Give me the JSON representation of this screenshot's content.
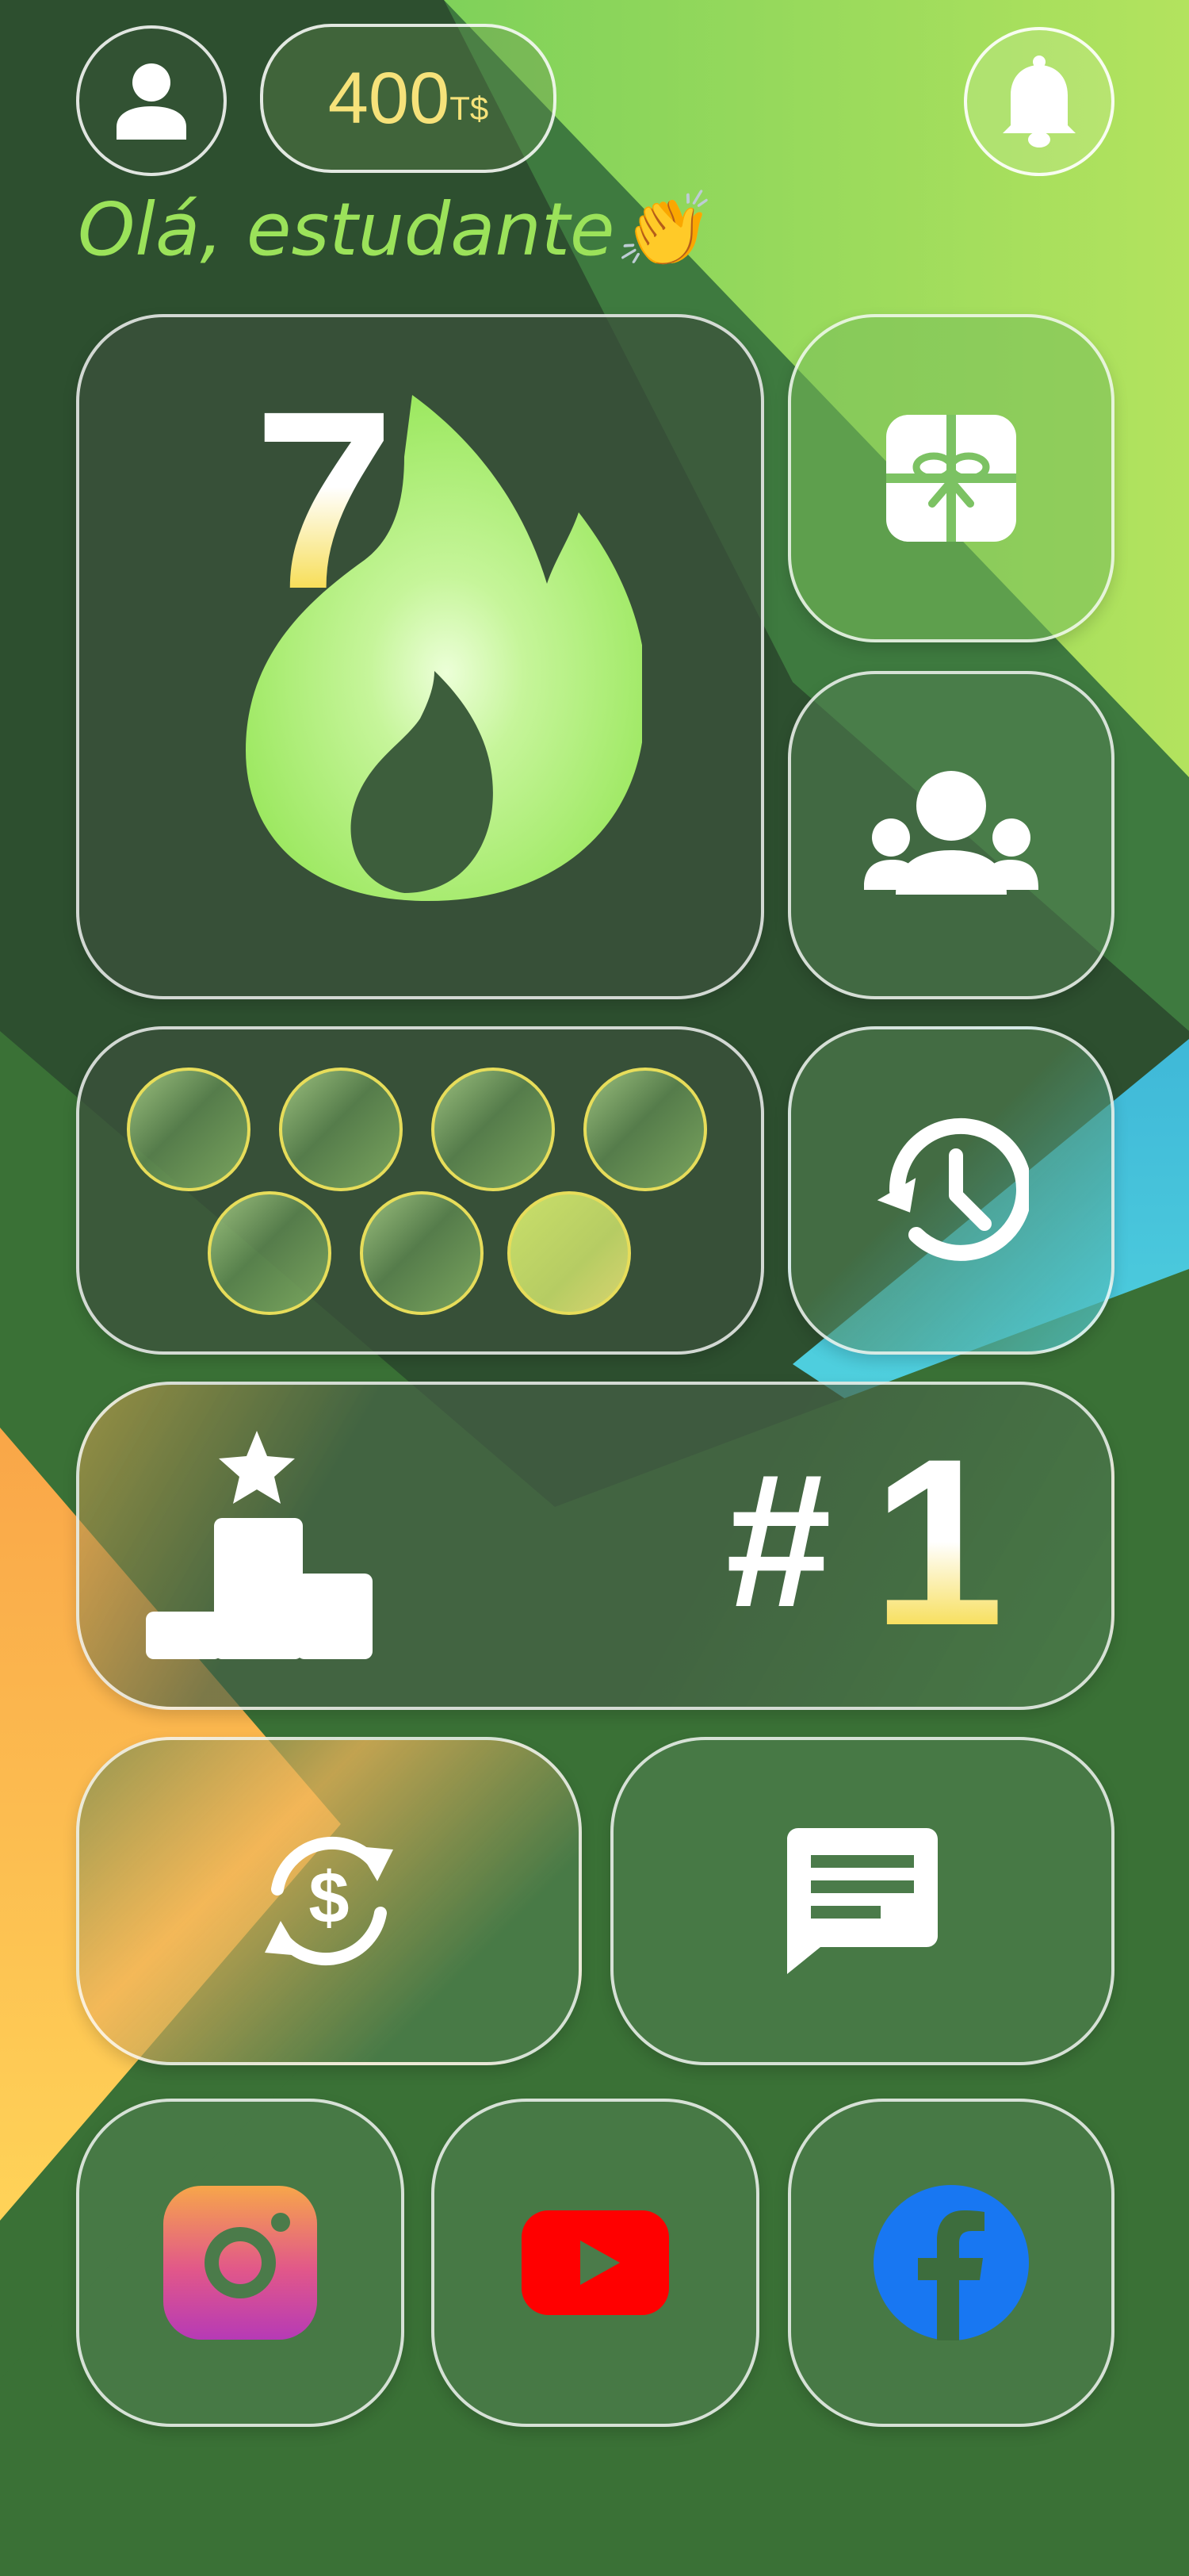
{
  "header": {
    "balance_amount": "400",
    "balance_currency": "T$",
    "greeting": "Olá, estudante👏"
  },
  "streak": {
    "days": "7"
  },
  "weekly_progress": {
    "total": 7,
    "completed": 0
  },
  "ranking": {
    "hash": "#",
    "position": "1"
  },
  "icons": {
    "profile": "user-icon",
    "notifications": "bell-icon",
    "gift": "gift-icon",
    "friends": "group-icon",
    "history": "history-icon",
    "ranking": "podium-star-icon",
    "exchange": "currency-exchange-icon",
    "chat": "chat-icon",
    "instagram": "instagram-icon",
    "youtube": "youtube-icon",
    "facebook": "facebook-icon"
  },
  "colors": {
    "greeting": "#9be25a",
    "currency": "#f6e27a",
    "accent_yellow": "#f4d21a",
    "flame": "#a8ef6a"
  }
}
